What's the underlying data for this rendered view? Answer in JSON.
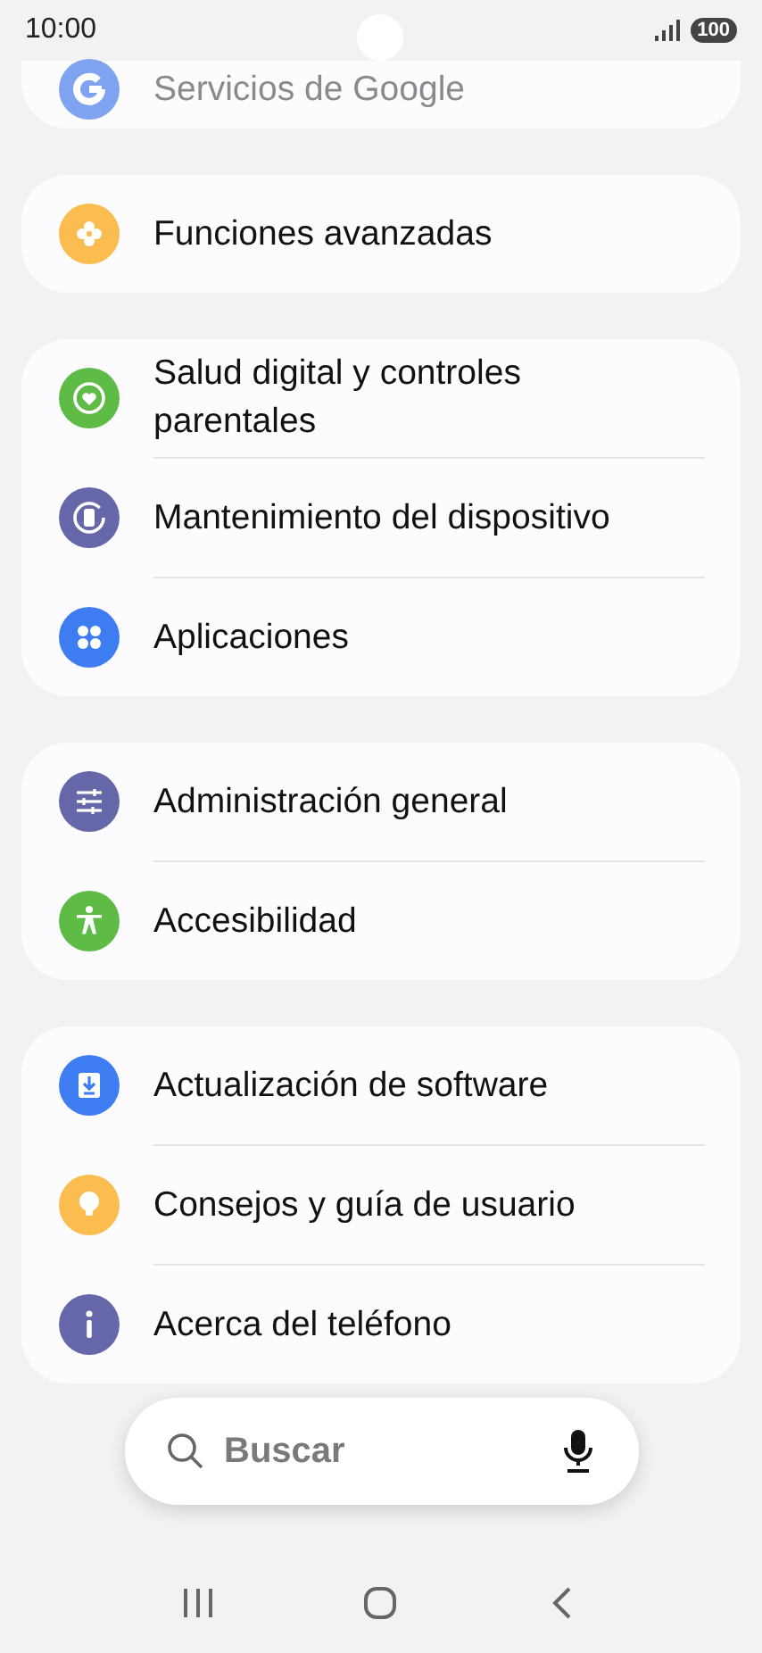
{
  "status_bar": {
    "time": "10:00",
    "battery": "100"
  },
  "groups": [
    {
      "items": [
        {
          "label": "Servicios de Google",
          "kind": "google",
          "color": "#7fa3f0"
        }
      ]
    },
    {
      "items": [
        {
          "label": "Funciones avanzadas",
          "kind": "flower",
          "color": "#fbbd4f"
        }
      ]
    },
    {
      "items": [
        {
          "label": "Salud digital y controles parentales",
          "kind": "heart",
          "color": "#5dbb46"
        },
        {
          "label": "Mantenimiento del dispositivo",
          "kind": "device",
          "color": "#6667a8"
        },
        {
          "label": "Aplicaciones",
          "kind": "apps",
          "color": "#3e7cf2"
        }
      ]
    },
    {
      "items": [
        {
          "label": "Administración general",
          "kind": "sliders",
          "color": "#6667a8"
        },
        {
          "label": "Accesibilidad",
          "kind": "person",
          "color": "#5dbb46"
        }
      ]
    },
    {
      "items": [
        {
          "label": "Actualización de software",
          "kind": "download",
          "color": "#3e7cf2"
        },
        {
          "label": "Consejos y guía de usuario",
          "kind": "bulb",
          "color": "#fbbd4f"
        },
        {
          "label": "Acerca del teléfono",
          "kind": "info",
          "color": "#6667a8"
        }
      ]
    }
  ],
  "search": {
    "placeholder": "Buscar"
  }
}
